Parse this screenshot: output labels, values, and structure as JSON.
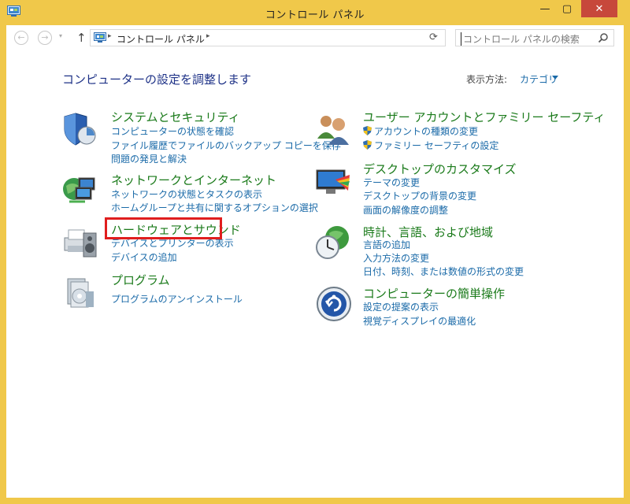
{
  "window": {
    "title": "コントロール パネル",
    "minimize": "—",
    "maximize": "▢",
    "close": "✕"
  },
  "nav": {
    "back": "←",
    "forward": "→",
    "dropdown": "▾",
    "up": "↑",
    "address_sep1": "▸",
    "address_text": "コントロール パネル",
    "address_sep2": "▸",
    "refresh": "⟳",
    "search_placeholder": "コントロール パネルの検索"
  },
  "main": {
    "heading": "コンピューターの設定を調整します",
    "view_by_label": "表示方法:",
    "view_by_value": "カテゴリ"
  },
  "categories": {
    "system": {
      "icon": "shield-icon",
      "title": "システムとセキュリティ",
      "links": [
        "コンピューターの状態を確認",
        "ファイル履歴でファイルのバックアップ コピーを保存",
        "問題の発見と解決"
      ]
    },
    "network": {
      "icon": "network-globe-icon",
      "title": "ネットワークとインターネット",
      "links": [
        "ネットワークの状態とタスクの表示",
        "ホームグループと共有に関するオプションの選択"
      ]
    },
    "hardware": {
      "icon": "printer-speaker-icon",
      "title": "ハードウェアとサウンド",
      "links": [
        "デバイスとプリンターの表示",
        "デバイスの追加"
      ]
    },
    "programs": {
      "icon": "programs-box-icon",
      "title": "プログラム",
      "links": [
        "プログラムのアンインストール"
      ]
    },
    "users": {
      "icon": "users-icon",
      "title": "ユーザー アカウントとファミリー セーフティ",
      "links": [
        "アカウントの種類の変更",
        "ファミリー セーフティの設定"
      ]
    },
    "desktop": {
      "icon": "desktop-monitor-icon",
      "title": "デスクトップのカスタマイズ",
      "links": [
        "テーマの変更",
        "デスクトップの背景の変更",
        "画面の解像度の調整"
      ]
    },
    "clock": {
      "icon": "clock-globe-icon",
      "title": "時計、言語、および地域",
      "links": [
        "言語の追加",
        "入力方法の変更",
        "日付、時刻、または数値の形式の変更"
      ]
    },
    "ease": {
      "icon": "ease-of-access-icon",
      "title": "コンピューターの簡単操作",
      "links": [
        "設定の提案の表示",
        "視覚ディスプレイの最適化"
      ]
    }
  },
  "colors": {
    "accent_frame": "#f0c84a",
    "heading": "#1e3287",
    "category_title": "#1a7a1a",
    "link": "#1a6aa8",
    "highlight": "#e01e1e",
    "close": "#c7483b"
  }
}
